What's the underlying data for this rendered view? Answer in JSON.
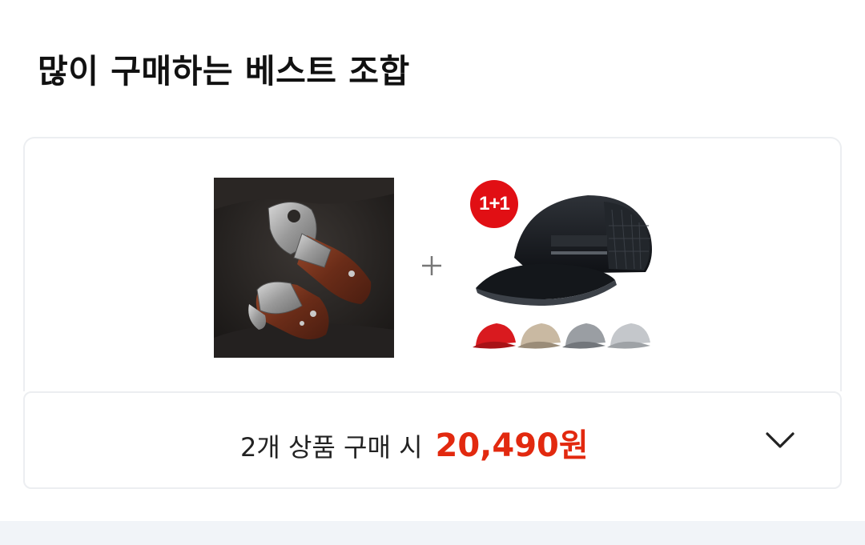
{
  "section": {
    "title": "많이 구매하는 베스트 조합"
  },
  "bundle": {
    "products": [
      {
        "icon": "folding-knife-product-image"
      },
      {
        "icon": "baseball-cap-product-image",
        "badge": "1+1"
      }
    ],
    "separator_icon": "plus-icon"
  },
  "summary": {
    "label": "2개 상품 구매 시",
    "price": "20,490원",
    "expand_icon": "chevron-down-icon"
  },
  "colors": {
    "price": "#e2290f",
    "badge": "#e10f14",
    "border": "#eceef1",
    "bottom_strip": "#f1f4f8"
  }
}
